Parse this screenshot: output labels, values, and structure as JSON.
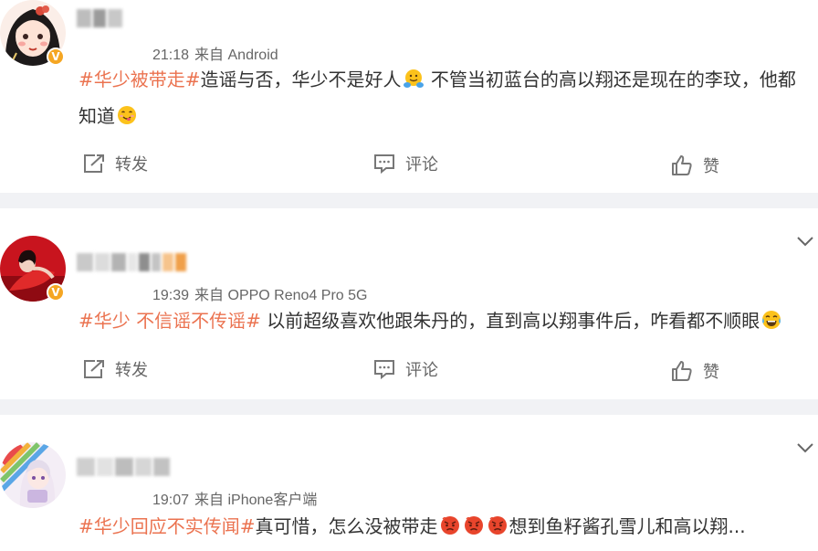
{
  "posts": [
    {
      "time": "21:18",
      "source": "来自 Android",
      "segments": [
        {
          "t": "tag",
          "v": "#华少被带走#"
        },
        {
          "t": "text",
          "v": "造谣与否，华少不是好人"
        },
        {
          "t": "emoji",
          "v": "hug-emoji"
        },
        {
          "t": "text",
          "v": " 不管当初蓝台的高以翔还是现在的李玟，他都知道"
        },
        {
          "t": "emoji",
          "v": "yum-emoji"
        }
      ],
      "actions": {
        "repost": "转发",
        "comment": "评论",
        "like": "赞"
      }
    },
    {
      "time": "19:39",
      "source": "来自 OPPO Reno4 Pro 5G",
      "segments": [
        {
          "t": "tag",
          "v": "#华少 不信谣不传谣#"
        },
        {
          "t": "text",
          "v": " 以前超级喜欢他跟朱丹的，直到高以翔事件后，咋看都不顺眼"
        },
        {
          "t": "emoji",
          "v": "laugh-tears-emoji"
        }
      ],
      "actions": {
        "repost": "转发",
        "comment": "评论",
        "like": "赞"
      }
    },
    {
      "time": "19:07",
      "source": "来自 iPhone客户端",
      "segments": [
        {
          "t": "tag",
          "v": "#华少回应不实传闻#"
        },
        {
          "t": "text",
          "v": "真可惜，怎么没被带走"
        },
        {
          "t": "emoji",
          "v": "angry-emoji"
        },
        {
          "t": "emoji",
          "v": "angry-emoji"
        },
        {
          "t": "emoji",
          "v": "angry-emoji"
        },
        {
          "t": "text",
          "v": "想到鱼籽酱孔雪儿和高以翔..."
        }
      ]
    }
  ],
  "colors": {
    "tag": "#eb7350",
    "verified": "#f5a623",
    "divider": "#f1f2f5"
  }
}
